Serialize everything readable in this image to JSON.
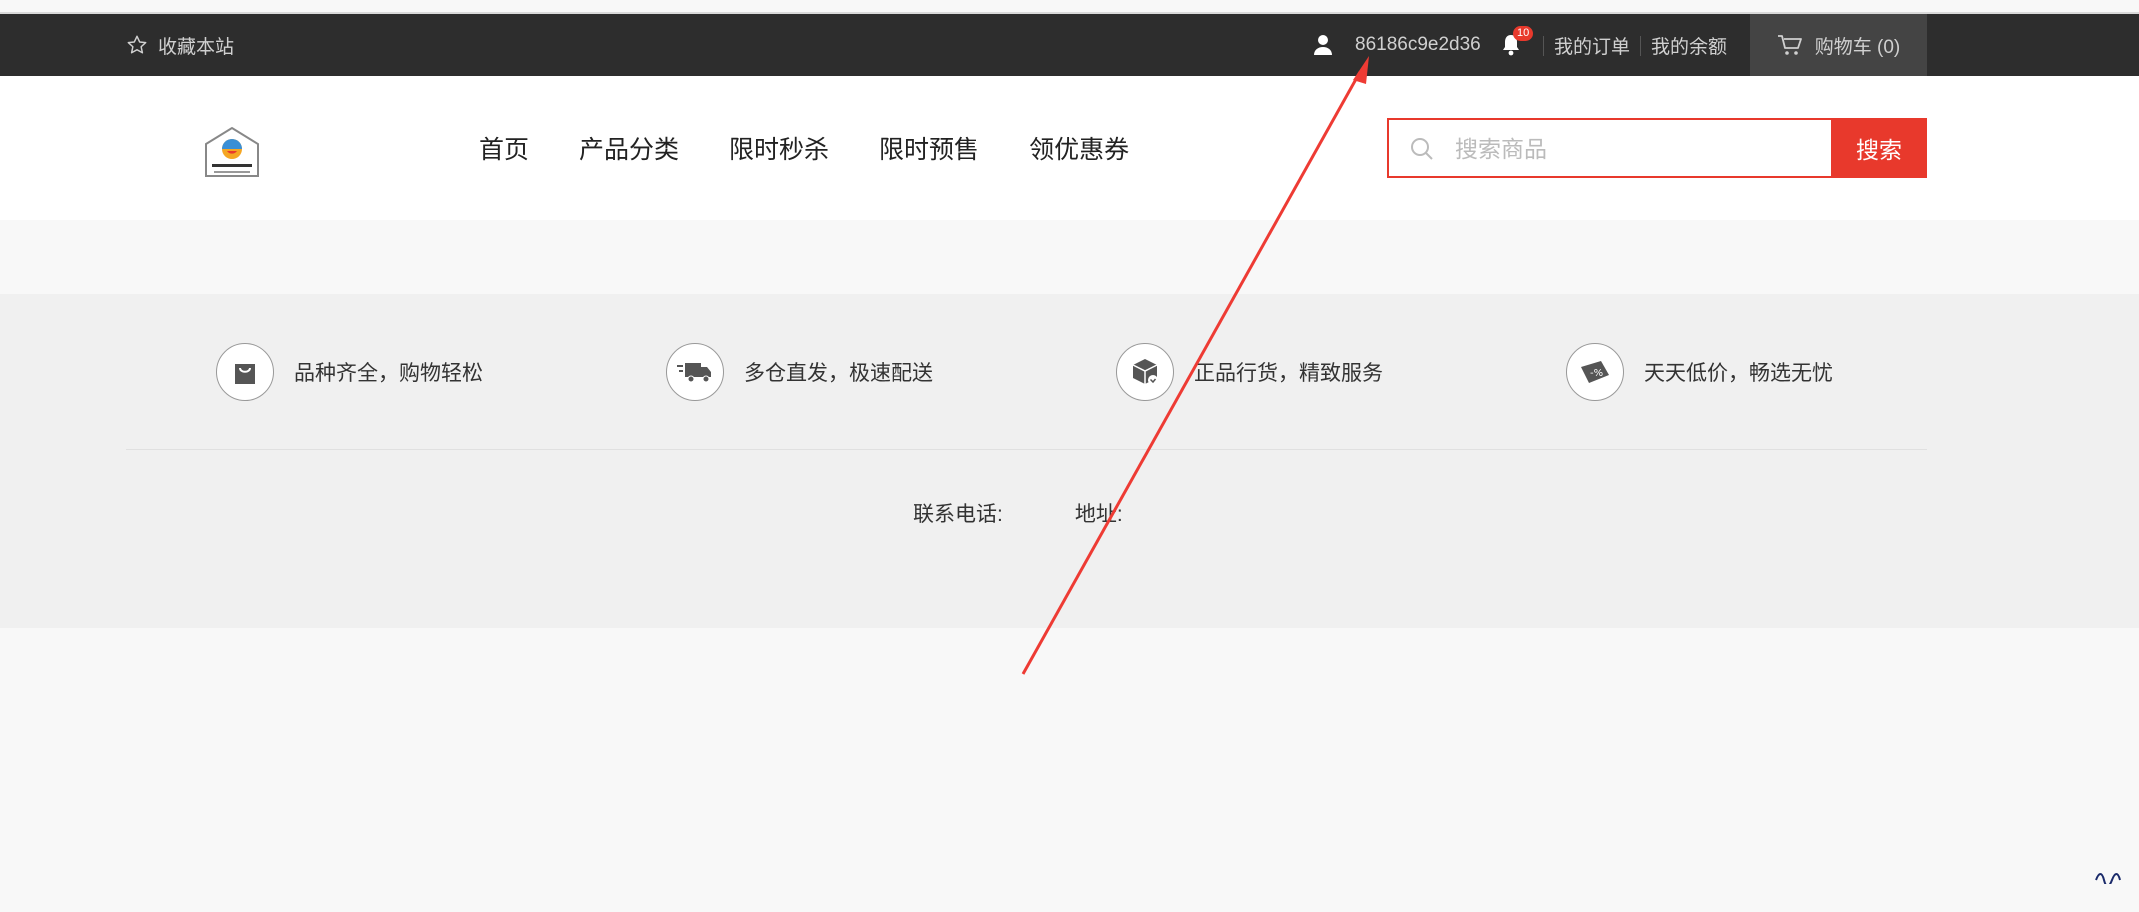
{
  "topbar": {
    "favorite_label": "收藏本站",
    "username": "86186c9e2d36",
    "notification_count": "10",
    "orders_label": "我的订单",
    "balance_label": "我的余额",
    "cart_label": "购物车 (0)"
  },
  "header": {
    "nav": [
      "首页",
      "产品分类",
      "限时秒杀",
      "限时预售",
      "领优惠券"
    ],
    "search_placeholder": "搜索商品",
    "search_button": "搜索"
  },
  "footer": {
    "features": [
      {
        "icon": "shopping-bag-icon",
        "label": "品种齐全，购物轻松"
      },
      {
        "icon": "delivery-truck-icon",
        "label": "多仓直发，极速配送"
      },
      {
        "icon": "package-box-icon",
        "label": "正品行货，精致服务"
      },
      {
        "icon": "discount-tag-icon",
        "label": "天天低价，畅选无忧"
      }
    ],
    "phone_label": "联系电话:",
    "address_label": "地址:"
  },
  "colors": {
    "accent": "#e8392c",
    "topbar_bg": "#2d2d2d",
    "annotation_arrow": "#ee3b34"
  }
}
